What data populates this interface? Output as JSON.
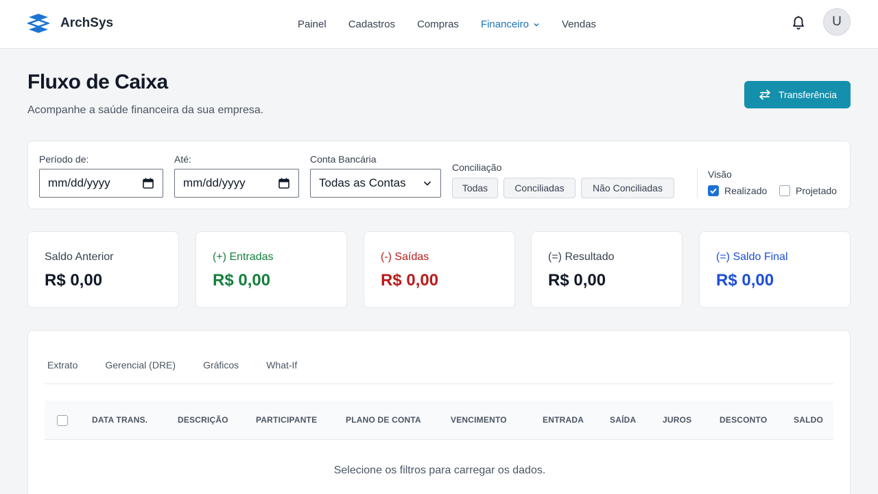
{
  "app": {
    "name": "ArchSys",
    "user_initial": "U"
  },
  "nav": {
    "items": [
      "Painel",
      "Cadastros",
      "Compras",
      "Financeiro",
      "Vendas"
    ],
    "active": "Financeiro"
  },
  "header": {
    "title": "Fluxo de Caixa",
    "subtitle": "Acompanhe a saúde financeira da sua empresa.",
    "transfer_label": "Transferência"
  },
  "filters": {
    "from_label": "Período de:",
    "from_value": "mm/dd/yyyy",
    "to_label": "Até:",
    "to_value": "mm/dd/yyyy",
    "account_label": "Conta Bancária",
    "account_value": "Todas as Contas",
    "reconciliation_label": "Conciliação",
    "reconciliation_options": [
      "Todas",
      "Conciliadas",
      "Não Conciliadas"
    ],
    "view_label": "Visão",
    "view_options": [
      {
        "label": "Realizado",
        "checked": true
      },
      {
        "label": "Projetado",
        "checked": false
      }
    ]
  },
  "summary": [
    {
      "label": "Saldo Anterior",
      "value": "R$ 0,00",
      "label_color": "#374151",
      "value_color": "#111827"
    },
    {
      "label": "(+) Entradas",
      "value": "R$ 0,00",
      "label_color": "#15803d",
      "value_color": "#15803d"
    },
    {
      "label": "(-) Saídas",
      "value": "R$ 0,00",
      "label_color": "#b91c1c",
      "value_color": "#b91c1c"
    },
    {
      "label": "(=) Resultado",
      "value": "R$ 0,00",
      "label_color": "#374151",
      "value_color": "#111827"
    },
    {
      "label": "(=) Saldo Final",
      "value": "R$ 0,00",
      "label_color": "#1d4ed8",
      "value_color": "#1d4ed8"
    }
  ],
  "tabs": [
    "Extrato",
    "Gerencial (DRE)",
    "Gráficos",
    "What-If"
  ],
  "table": {
    "columns": [
      "DATA TRANS.",
      "DESCRIÇÃO",
      "PARTICIPANTE",
      "PLANO DE CONTA",
      "VENCIMENTO",
      "ENTRADA",
      "SAÍDA",
      "JUROS",
      "DESCONTO",
      "SALDO"
    ],
    "empty_message": "Selecione os filtros para carregar os dados."
  }
}
